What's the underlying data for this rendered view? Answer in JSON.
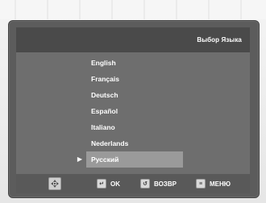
{
  "menu": {
    "title": "Выбор Языка",
    "selected_index": 6,
    "items": [
      {
        "label": "English"
      },
      {
        "label": "Français"
      },
      {
        "label": "Deutsch"
      },
      {
        "label": "Español"
      },
      {
        "label": "Italiano"
      },
      {
        "label": "Nederlands"
      },
      {
        "label": "Русский"
      }
    ]
  },
  "footer": {
    "nav_icon": "directional-pad-icon",
    "ok": {
      "icon": "enter-icon",
      "label": "OK"
    },
    "back": {
      "icon": "return-icon",
      "label": "ВОЗВР"
    },
    "menu": {
      "icon": "menu-icon",
      "label": "МЕНЮ"
    }
  },
  "colors": {
    "background": "#eeeeee",
    "frame": "#5c5c5c",
    "screen": "#6e6e6e",
    "header": "#4a4a4a",
    "selected": "#9a9a9a",
    "footer": "#595959",
    "text": "#ffffff"
  }
}
